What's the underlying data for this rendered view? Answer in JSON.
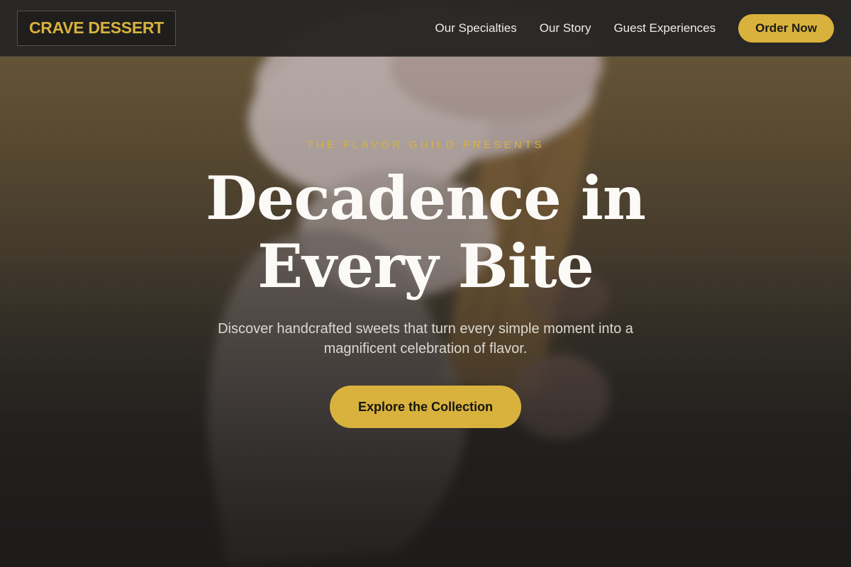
{
  "brand": {
    "logo_text": "CRAVE DESSERT"
  },
  "nav": {
    "links": [
      {
        "label": "Our Specialties"
      },
      {
        "label": "Our Story"
      },
      {
        "label": "Guest Experiences"
      }
    ],
    "order_button": "Order Now"
  },
  "hero": {
    "eyebrow": "THE FLAVOR GUILD PRESENTS",
    "headline_line1": "Decadence in",
    "headline_line2": "Every Bite",
    "subtext": "Discover handcrafted sweets that turn every simple moment into a magnificent celebration of flavor.",
    "cta": "Explore the Collection",
    "background_image": "blurred ice cream cone held in hand"
  },
  "colors": {
    "accent": "#d8b23d",
    "header_bg": "#262524",
    "text_light": "#fbfaf7"
  }
}
